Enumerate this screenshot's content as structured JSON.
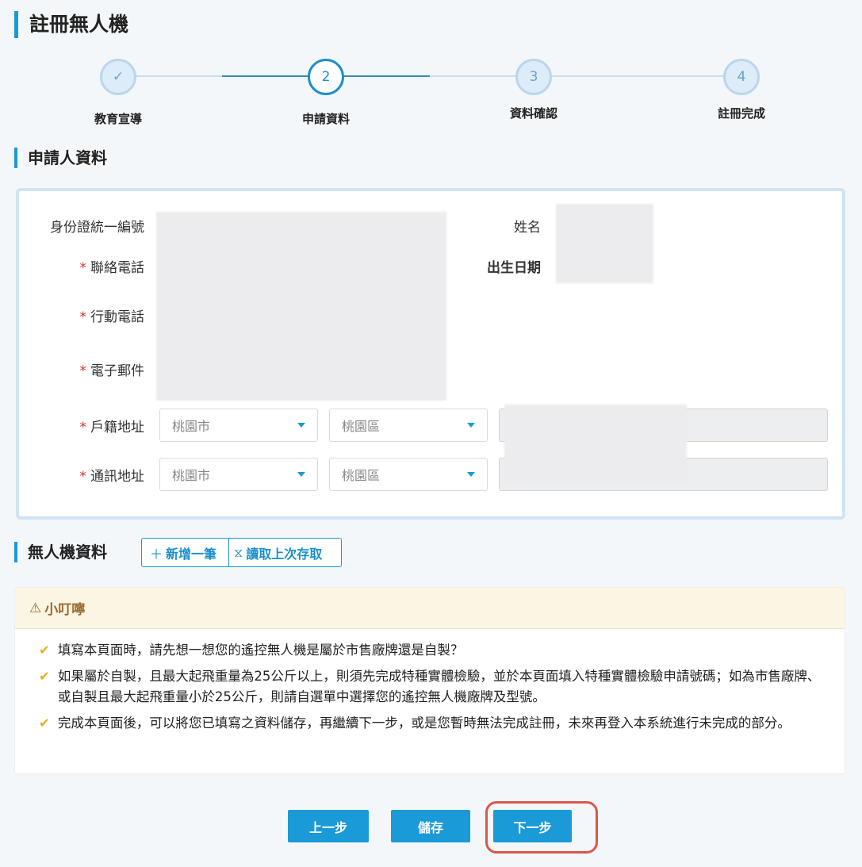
{
  "page_title": "註冊無人機",
  "steps": [
    {
      "label": "教育宣導",
      "mark": "✓",
      "state": "done"
    },
    {
      "label": "申請資料",
      "mark": "2",
      "state": "current"
    },
    {
      "label": "資料確認",
      "mark": "3",
      "state": "todo"
    },
    {
      "label": "註冊完成",
      "mark": "4",
      "state": "todo"
    }
  ],
  "applicant": {
    "title": "申請人資料",
    "id_label": "身份證統一編號",
    "name_label": "姓名",
    "phone_label": "聯絡電話",
    "birth_label": "出生日期",
    "mobile_label": "行動電話",
    "email_label": "電子郵件",
    "household_label": "戶籍地址",
    "mail_label": "通訊地址",
    "required_mark": "*",
    "household_city": "桃園市",
    "household_district": "桃園區",
    "mail_city": "桃園市",
    "mail_district": "桃園區"
  },
  "drone": {
    "title": "無人機資料",
    "add_label": "新增一筆",
    "load_label": "讀取上次存取"
  },
  "notice": {
    "title": "小叮嚀",
    "items": [
      "填寫本頁面時，請先想一想您的遙控無人機是屬於市售廠牌還是自製？",
      "如果屬於自製，且最大起飛重量為25公斤以上，則須先完成特種實體檢驗，並於本頁面填入特種實體檢驗申請號碼；如為市售廠牌、或自製且最大起飛重量小於25公斤，則請自選單中選擇您的遙控無人機廠牌及型號。",
      "完成本頁面後，可以將您已填寫之資料儲存，再繼續下一步，或是您暫時無法完成註冊，未來再登入本系統進行未完成的部分。"
    ]
  },
  "buttons": {
    "prev": "上一步",
    "save": "儲存",
    "next": "下一步"
  },
  "colors": {
    "accent": "#1a9ad6",
    "highlight": "#d9584c"
  }
}
